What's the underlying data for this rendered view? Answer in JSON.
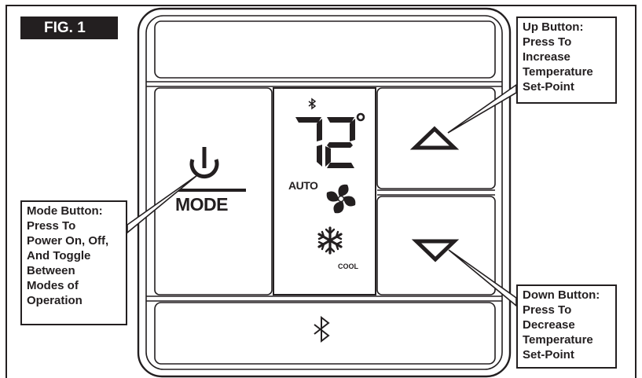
{
  "figure": {
    "label": "FIG. 1"
  },
  "display": {
    "temperature": "72",
    "degree_symbol": "°",
    "fan_mode": "AUTO",
    "system_mode": "COOL"
  },
  "mode_button": {
    "label": "MODE"
  },
  "callouts": {
    "up": [
      "Up Button:",
      "Press To",
      "Increase",
      "Temperature",
      "Set-Point"
    ],
    "mode": [
      "Mode Button:",
      "Press To",
      "Power On, Off,",
      "And Toggle",
      "Between",
      "Modes of",
      "Operation"
    ],
    "down": [
      "Down Button:",
      "Press To",
      "Decrease",
      "Temperature",
      "Set-Point"
    ]
  },
  "icons": {
    "power": "power-icon",
    "fan": "fan-icon",
    "snowflake": "snowflake-icon",
    "bluetooth": "bluetooth-icon",
    "up": "up-triangle-icon",
    "down": "down-triangle-icon"
  },
  "colors": {
    "ink": "#231f20",
    "paper": "#ffffff"
  }
}
